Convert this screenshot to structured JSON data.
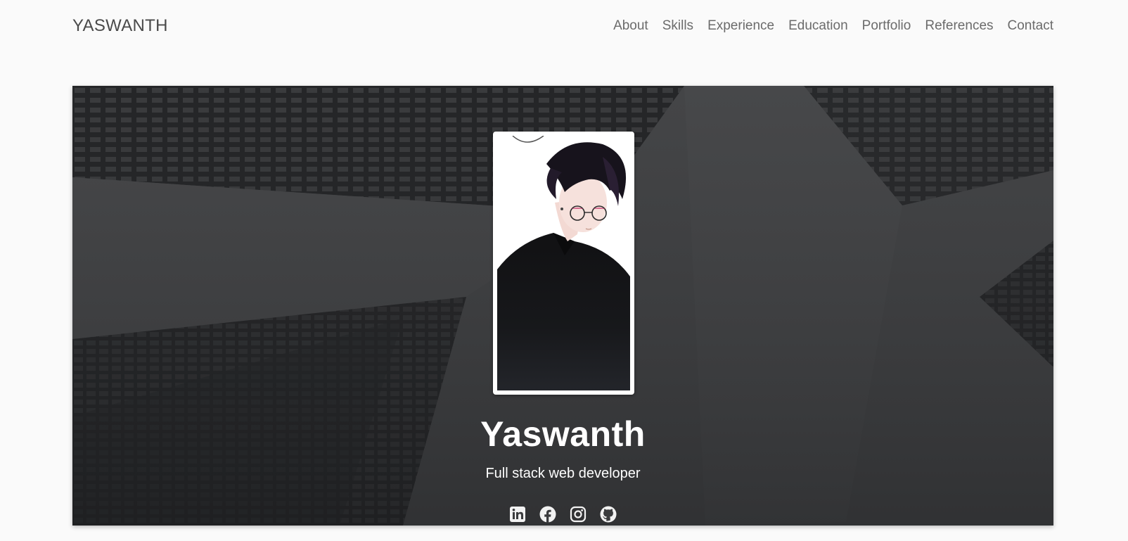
{
  "nav": {
    "brand": "YASWANTH",
    "links": [
      "About",
      "Skills",
      "Experience",
      "Education",
      "Portfolio",
      "References",
      "Contact"
    ]
  },
  "hero": {
    "name": "Yaswanth",
    "title": "Full stack web developer",
    "portrait": "anime-style portrait",
    "social_icons": [
      "linkedin-icon",
      "facebook-icon",
      "instagram-icon",
      "github-icon"
    ]
  },
  "colors": {
    "page_background": "#fafafa",
    "nav_text": "#6b6b6b",
    "hero_overlay": "#3f4042",
    "hero_text": "#ffffff"
  }
}
